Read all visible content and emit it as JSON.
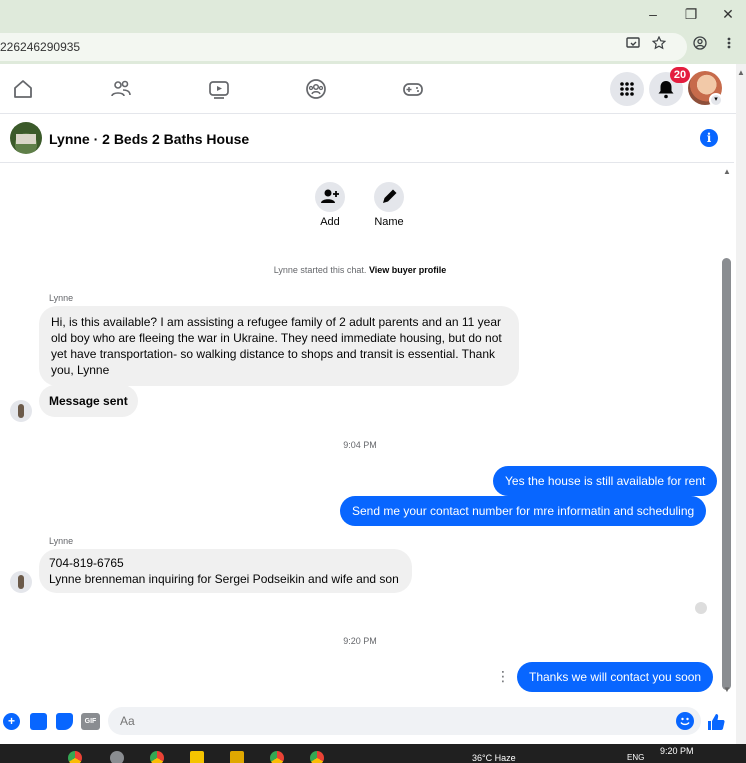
{
  "browser": {
    "url": "226246290935",
    "window_controls": {
      "minimize": "–",
      "restore": "❐",
      "close": "✕"
    }
  },
  "nav": {
    "notification_count": "20"
  },
  "chat": {
    "title": "Lynne · 2 Beds 2 Baths House",
    "info_glyph": "i",
    "actions": [
      {
        "label": "Add",
        "icon": "add-person-icon"
      },
      {
        "label": "Name",
        "icon": "pencil-icon"
      }
    ],
    "system_text": "Lynne started this chat.",
    "system_link": "View buyer profile",
    "messages": [
      {
        "sender": "Lynne",
        "direction": "in",
        "text": "Hi, is this available? I am assisting a refugee family of 2 adult parents and an 11 year old boy who are fleeing the war in Ukraine. They need immediate housing, but do not yet have transportation- so walking distance to shops and transit is essential. Thank you, Lynne"
      },
      {
        "direction": "in",
        "text": "Message sent"
      },
      {
        "timestamp": "9:04 PM"
      },
      {
        "direction": "out",
        "text": "Yes the house is still available for rent"
      },
      {
        "direction": "out",
        "text": "Send me your contact number for mre informatin and  scheduling"
      },
      {
        "sender": "Lynne",
        "direction": "in",
        "lines": [
          "704-819-6765",
          "Lynne brenneman inquiring for Sergei Podseikin and wife and son"
        ]
      },
      {
        "timestamp": "9:20 PM"
      },
      {
        "direction": "out",
        "text": "Thanks we will contact you soon"
      }
    ],
    "more_glyph": "⋮"
  },
  "composer": {
    "placeholder": "Aa",
    "gif_label": "GIF"
  },
  "taskbar": {
    "weather": "36°C  Haze",
    "language": "ENG",
    "time": "9:20 PM"
  },
  "colors": {
    "accent": "#0866ff",
    "incoming_bubble": "#f0f0f0",
    "browser_chrome": "#dfeadb",
    "badge": "#e41e3f"
  }
}
